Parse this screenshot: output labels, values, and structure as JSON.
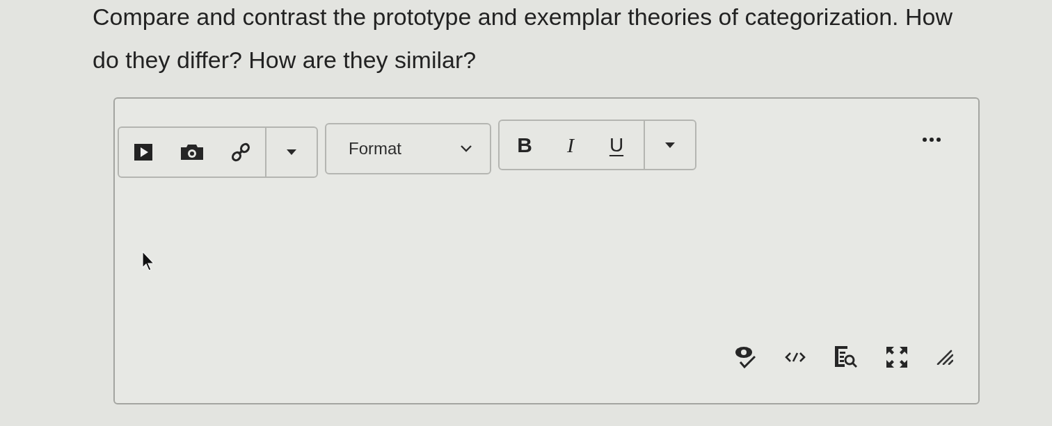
{
  "question": "Compare and contrast the prototype and exemplar theories of categorization. How do they differ? How are they similar?",
  "editor": {
    "format_select": {
      "value": "Format"
    },
    "style_buttons": [
      {
        "kind": "bold",
        "label": "B"
      },
      {
        "kind": "italic",
        "label": "I"
      },
      {
        "kind": "underline",
        "label": "U"
      }
    ]
  }
}
